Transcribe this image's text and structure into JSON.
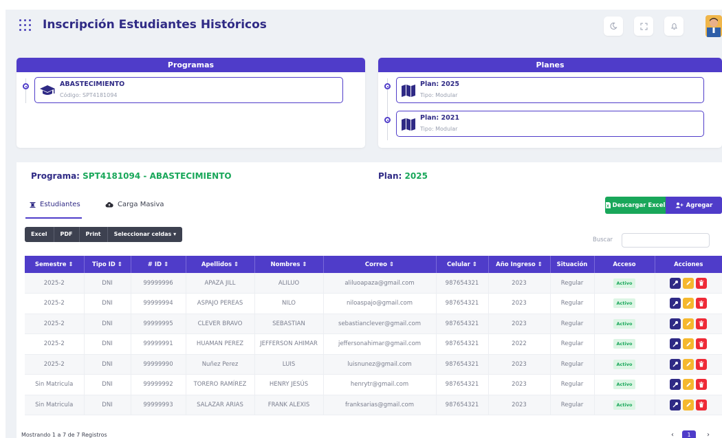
{
  "header": {
    "title": "Inscripción Estudiantes Históricos"
  },
  "programas": {
    "heading": "Programas",
    "items": [
      {
        "name": "ABASTECIMIENTO",
        "code": "Código: SPT4181094"
      }
    ]
  },
  "planes": {
    "heading": "Planes",
    "items": [
      {
        "name": "Plan: 2025",
        "type": "Tipo: Modular"
      },
      {
        "name": "Plan: 2021",
        "type": "Tipo: Modular"
      }
    ]
  },
  "selection": {
    "programa_label": "Programa:",
    "programa_value": "SPT4181094 - ABASTECIMIENTO",
    "plan_label": "Plan:",
    "plan_value": "2025"
  },
  "tabs": {
    "estudiantes": "Estudiantes",
    "carga": "Carga Masiva"
  },
  "actions": {
    "excel": "Descargar Excel",
    "add": "Agregar"
  },
  "dt_buttons": {
    "excel": "Excel",
    "pdf": "PDF",
    "print": "Print",
    "select": "Seleccionar celdas"
  },
  "search": {
    "label": "Buscar",
    "value": ""
  },
  "table": {
    "columns": [
      "Semestre",
      "Tipo ID",
      "# ID",
      "Apellidos",
      "Nombres",
      "Correo",
      "Celular",
      "Año Ingreso",
      "Situación",
      "Acceso",
      "Acciones"
    ],
    "rows": [
      {
        "semestre": "2025-2",
        "tipo": "DNI",
        "id": "99999996",
        "apellidos": "APAZA JILL",
        "nombres": "ALILUO",
        "correo": "aliluoapaza@gmail.com",
        "celular": "987654321",
        "ingreso": "2023",
        "situacion": "Regular",
        "acceso": "Activo"
      },
      {
        "semestre": "2025-2",
        "tipo": "DNI",
        "id": "99999994",
        "apellidos": "ASPAJO PEREAS",
        "nombres": "NILO",
        "correo": "niloaspajo@gmail.com",
        "celular": "987654321",
        "ingreso": "2023",
        "situacion": "Regular",
        "acceso": "Activo"
      },
      {
        "semestre": "2025-2",
        "tipo": "DNI",
        "id": "99999995",
        "apellidos": "CLEVER BRAVO",
        "nombres": "SEBASTIAN",
        "correo": "sebastianclever@gmail.com",
        "celular": "987654321",
        "ingreso": "2023",
        "situacion": "Regular",
        "acceso": "Activo"
      },
      {
        "semestre": "2025-2",
        "tipo": "DNI",
        "id": "99999991",
        "apellidos": "HUAMAN PEREZ",
        "nombres": "JEFFERSON AHIMAR",
        "correo": "jeffersonahimar@gmail.com",
        "celular": "987654321",
        "ingreso": "2022",
        "situacion": "Regular",
        "acceso": "Activo"
      },
      {
        "semestre": "2025-2",
        "tipo": "DNI",
        "id": "99999990",
        "apellidos": "Nuñez Perez",
        "nombres": "LUIS",
        "correo": "luisnunez@gmail.com",
        "celular": "987654321",
        "ingreso": "2023",
        "situacion": "Regular",
        "acceso": "Activo"
      },
      {
        "semestre": "Sin Matricula",
        "tipo": "DNI",
        "id": "99999992",
        "apellidos": "TORERO RAMÍREZ",
        "nombres": "HENRY JESÚS",
        "correo": "henrytr@gmail.com",
        "celular": "987654321",
        "ingreso": "2023",
        "situacion": "Regular",
        "acceso": "Activo"
      },
      {
        "semestre": "Sin Matricula",
        "tipo": "DNI",
        "id": "99999993",
        "apellidos": "SALAZAR ARIAS",
        "nombres": "FRANK ALEXIS",
        "correo": "franksarias@gmail.com",
        "celular": "987654321",
        "ingreso": "2023",
        "situacion": "Regular",
        "acceso": "Activo"
      }
    ]
  },
  "footer": {
    "info": "Mostrando 1 a 7 de 7 Registros",
    "current_page": "1"
  },
  "colors": {
    "primary": "#4f3cc9",
    "navy": "#2f2a85",
    "green": "#19a75a",
    "yellow": "#f5b82e",
    "red": "#ee2a37"
  }
}
